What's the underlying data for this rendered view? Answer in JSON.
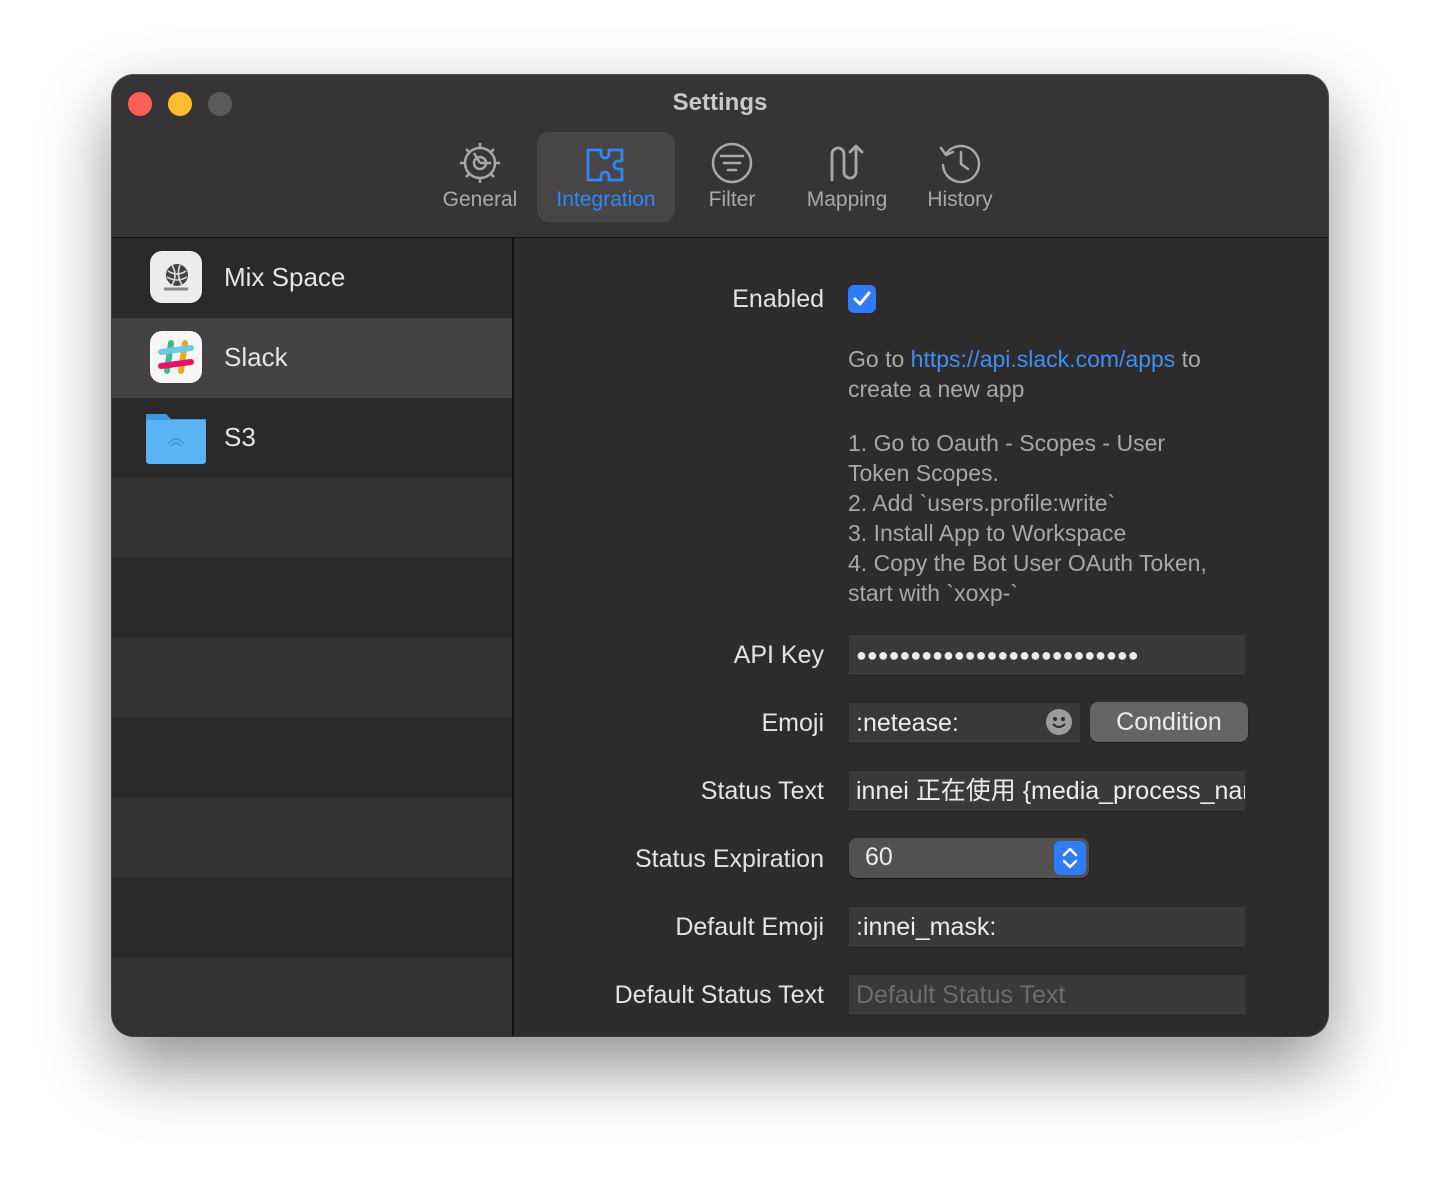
{
  "window": {
    "title": "Settings"
  },
  "toolbar": {
    "items": [
      {
        "label": "General",
        "icon": "gear-icon"
      },
      {
        "label": "Integration",
        "icon": "puzzle-icon",
        "active": true
      },
      {
        "label": "Filter",
        "icon": "filter-icon"
      },
      {
        "label": "Mapping",
        "icon": "mapping-icon"
      },
      {
        "label": "History",
        "icon": "history-icon"
      }
    ]
  },
  "sidebar": {
    "items": [
      {
        "label": "Mix Space",
        "icon": "mix-space-app-icon"
      },
      {
        "label": "Slack",
        "icon": "slack-app-icon",
        "selected": true
      },
      {
        "label": "S3",
        "icon": "folder-icon"
      }
    ]
  },
  "form": {
    "enabled": {
      "label": "Enabled",
      "checked": true
    },
    "help": {
      "line1_prefix": "Go to ",
      "link": "https://api.slack.com/apps",
      "line1_suffix": " to",
      "line2": "create a new app",
      "steps": [
        "1. Go to Oauth - Scopes - User",
        "Token Scopes.",
        "2. Add `users.profile:write`",
        "3. Install App to Workspace",
        "4. Copy the Bot User OAuth Token,",
        "start with `xoxp-`"
      ]
    },
    "api_key": {
      "label": "API Key",
      "value": "●●●●●●●●●●●●●●●●●●●●●●●●●●"
    },
    "emoji": {
      "label": "Emoji",
      "value": ":netease:",
      "button": "Condition"
    },
    "status_text": {
      "label": "Status Text",
      "value": "innei 正在使用 {media_process_name}"
    },
    "status_expiration": {
      "label": "Status Expiration",
      "value": "60"
    },
    "default_emoji": {
      "label": "Default Emoji",
      "value": ":innei_mask:"
    },
    "default_status_text": {
      "label": "Default Status Text",
      "placeholder": "Default Status Text",
      "value": ""
    }
  },
  "colors": {
    "accent": "#2f7cf6",
    "link": "#3b90f5",
    "window_bg": "#2d2b2b"
  }
}
